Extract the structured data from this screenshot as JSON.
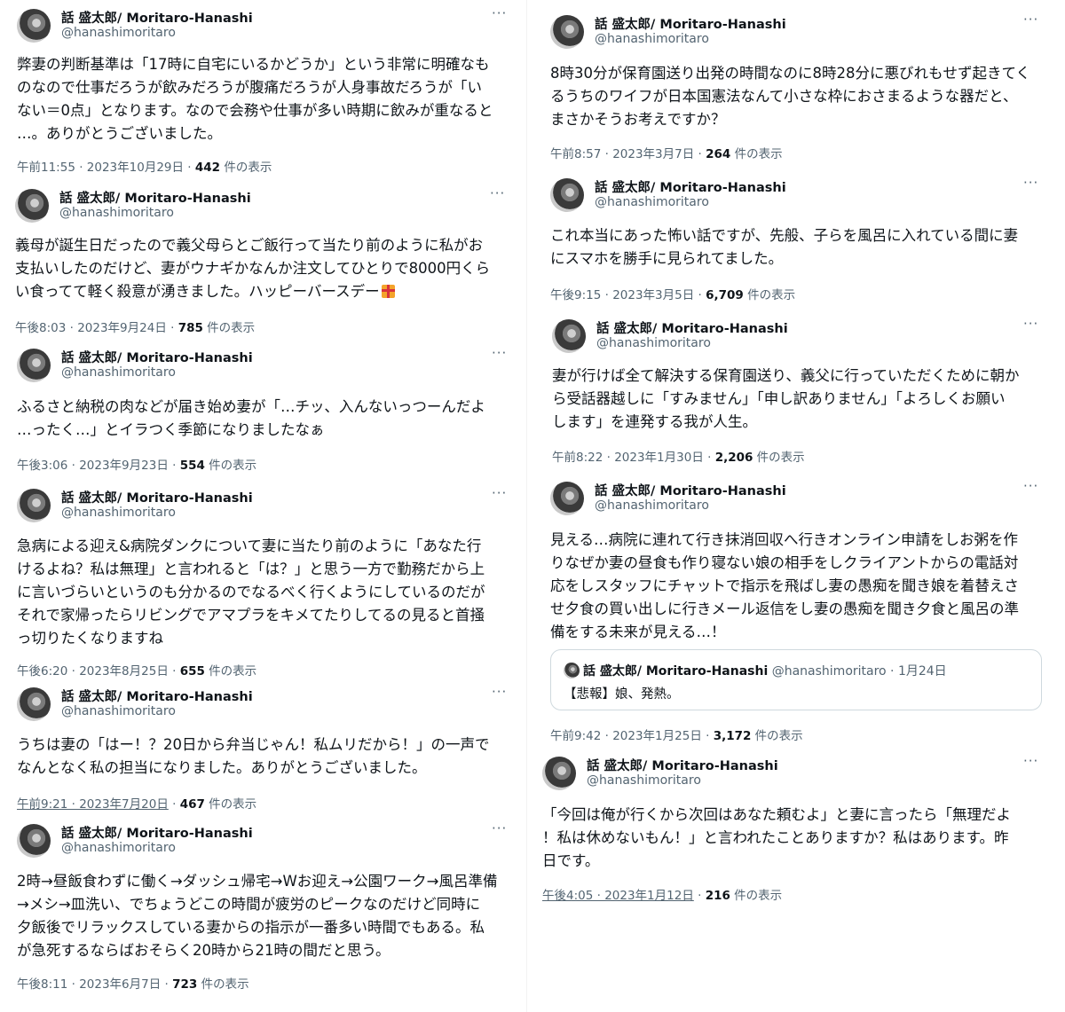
{
  "author": {
    "name": "話 盛太郎/ Moritaro-Hanashi",
    "handle": "@hanashimoritaro"
  },
  "more_label": "···",
  "views_suffix": " 件の表示",
  "tweets": [
    {
      "text": "弊妻の判断基準は「17時に自宅にいるかどうか」という非常に明確なも\nのなので仕事だろうが飲みだろうが腹痛だろうが人身事故だろうが「い\nない＝0点」となります。なので会務や仕事が多い時期に飲みが重なると\n…。ありがとうございました。",
      "time": "午前11:55 · 2023年10月29日 · ",
      "views": "442"
    },
    {
      "text": "義母が誕生日だったので義父母らとご飯行って当たり前のように私がお\n支払いしたのだけど、妻がウナギかなんか注文してひとりで8000円くら\nい食ってて軽く殺意が湧きました。ハッピーバースデー",
      "time": "午後8:03 · 2023年9月24日 · ",
      "views": "785"
    },
    {
      "text": "ふるさと納税の肉などが届き始め妻が「…チッ、入んないっつーんだよ\n…ったく…」とイラつく季節になりましたなぁ",
      "time": "午後3:06 · 2023年9月23日 · ",
      "views": "554"
    },
    {
      "text": "急病による迎え&病院ダンクについて妻に当たり前のように「あなた行\nけるよね？私は無理」と言われると「は？」と思う一方で勤務だから上\nに言いづらいというのも分かるのでなるべく行くようにしているのだが\nそれで家帰ったらリビングでアマプラをキメてたりしてるの見ると首掻\nっ切りたくなりますね",
      "time": "午後6:20 · 2023年8月25日 · ",
      "views": "655"
    },
    {
      "text": "うちは妻の「はー！？20日から弁当じゃん！私ムリだから！」の一声で\nなんとなく私の担当になりました。ありがとうございました。",
      "time": "午前9:21 · 2023年7月20日",
      "views": "467"
    },
    {
      "text": "2時→昼飯食わずに働く→ダッシュ帰宅→Wお迎え→公園ワーク→風呂準備\n→メシ→皿洗い、でちょうどこの時間が疲労のピークなのだけど同時に\n夕飯後でリラックスしている妻からの指示が一番多い時間でもある。私\nが急死するならばおそらく20時から21時の間だと思う。",
      "time": "午後8:11 · 2023年6月7日 · ",
      "views": "723"
    },
    {
      "text": "8時30分が保育園送り出発の時間なのに8時28分に悪びれもせず起きてく\nるうちのワイフが日本国憲法なんて小さな枠におさまるような器だと、\nまさかそうお考えですか？",
      "time": "午前8:57 · 2023年3月7日 · ",
      "views": "264"
    },
    {
      "text": "これ本当にあった怖い話ですが、先般、子らを風呂に入れている間に妻\nにスマホを勝手に見られてました。",
      "time": "午後9:15 · 2023年3月5日 · ",
      "views": "6,709"
    },
    {
      "text": "妻が行けば全て解決する保育園送り、義父に行っていただくために朝か\nら受話器越しに「すみません」「申し訳ありません」「よろしくお願い\nします」を連発する我が人生。",
      "time": "午前8:22 · 2023年1月30日 · ",
      "views": "2,206"
    },
    {
      "text": "見える…病院に連れて行き抹消回収へ行きオンライン申請をしお粥を作\nりなぜか妻の昼食も作り寝ない娘の相手をしクライアントからの電話対\n応をしスタッフにチャットで指示を飛ばし妻の愚痴を聞き娘を着替えさ\nせ夕食の買い出しに行きメール返信をし妻の愚痴を聞き夕食と風呂の準\n備をする未来が見える…！",
      "time": "午前9:42 · 2023年1月25日 · ",
      "views": "3,172",
      "quote": {
        "name": "話 盛太郎/ Moritaro-Hanashi",
        "meta": " @hanashimoritaro · 1月24日",
        "text": "【悲報】娘、発熱。"
      }
    },
    {
      "text": "「今回は俺が行くから次回はあなた頼むよ」と妻に言ったら「無理だよ\n！私は休めないもん！」と言われたことありますか？私はあります。昨\n日です。",
      "time": "午後4:05 · 2023年1月12日",
      "views": "216"
    }
  ]
}
